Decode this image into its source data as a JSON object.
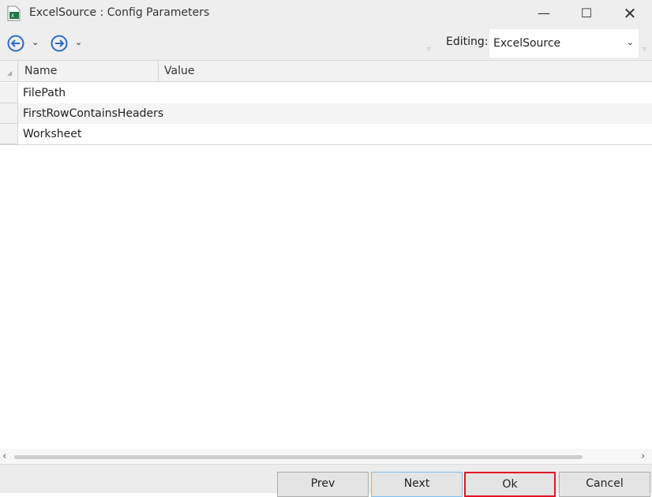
{
  "window": {
    "title": "ExcelSource : Config Parameters",
    "icon": "excel-file-icon"
  },
  "toolbar": {
    "editing_label": "Editing:",
    "editing_value": "ExcelSource"
  },
  "grid": {
    "columns": [
      "Name",
      "Value"
    ],
    "rows": [
      {
        "name": "FilePath",
        "value": ""
      },
      {
        "name": "FirstRowContainsHeaders",
        "value": ""
      },
      {
        "name": "Worksheet",
        "value": ""
      }
    ]
  },
  "buttons": {
    "prev": "Prev",
    "next": "Next",
    "ok": "Ok",
    "cancel": "Cancel"
  },
  "colors": {
    "accent": "#2b6cc4",
    "highlight": "#e81123"
  }
}
